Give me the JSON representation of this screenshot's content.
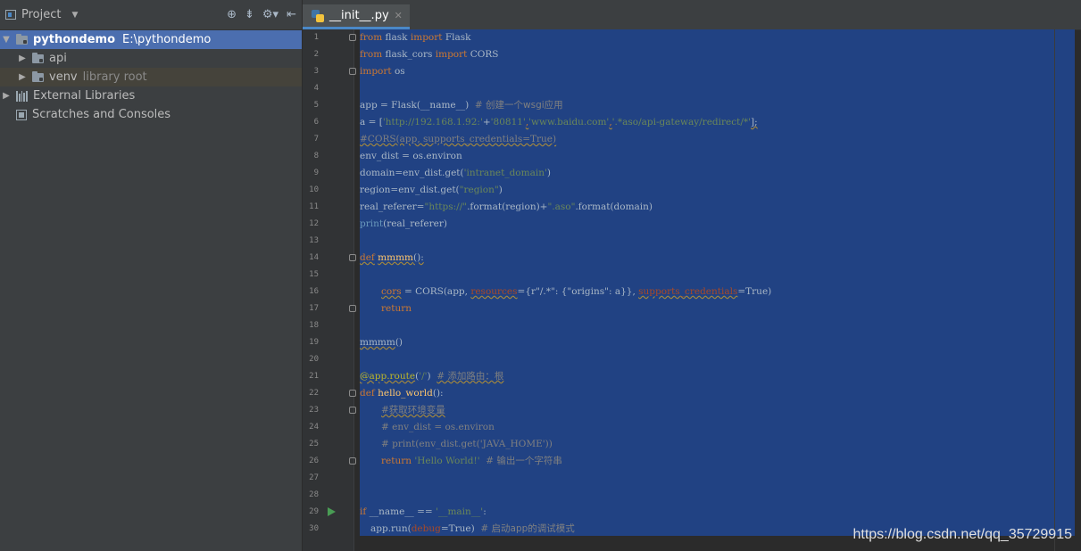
{
  "project_panel": {
    "title": "Project",
    "tree": [
      {
        "label": "pythondemo",
        "extra": "E:\\pythondemo",
        "selected": true
      },
      {
        "label": "api"
      },
      {
        "label": "venv",
        "extra": "library root"
      },
      {
        "label": "External Libraries"
      },
      {
        "label": "Scratches and Consoles"
      }
    ]
  },
  "editor": {
    "tab_label": "__init__.py",
    "lines": [
      {
        "n": "1"
      },
      {
        "n": "2"
      },
      {
        "n": "3"
      },
      {
        "n": "4"
      },
      {
        "n": "5"
      },
      {
        "n": "6"
      },
      {
        "n": "7"
      },
      {
        "n": "8"
      },
      {
        "n": "9"
      },
      {
        "n": "10"
      },
      {
        "n": "11"
      },
      {
        "n": "12"
      },
      {
        "n": "13"
      },
      {
        "n": "14"
      },
      {
        "n": "15"
      },
      {
        "n": "16"
      },
      {
        "n": "17"
      },
      {
        "n": "18"
      },
      {
        "n": "19"
      },
      {
        "n": "20"
      },
      {
        "n": "21"
      },
      {
        "n": "22"
      },
      {
        "n": "23"
      },
      {
        "n": "24"
      },
      {
        "n": "25"
      },
      {
        "n": "26"
      },
      {
        "n": "27"
      },
      {
        "n": "28"
      },
      {
        "n": "29"
      },
      {
        "n": "30"
      }
    ],
    "code": {
      "l1a": "from",
      "l1b": " flask ",
      "l1c": "import",
      "l1d": " Flask",
      "l2a": "from",
      "l2b": " flask_cors ",
      "l2c": "import",
      "l2d": " CORS",
      "l3a": "import",
      "l3b": " os",
      "l5a": "app = Flask(__name__)  ",
      "l5b": "# 创建一个wsgi应用",
      "l6a": "a = [",
      "l6b": "'http://192.168.1.92:'",
      "l6c": "+",
      "l6d": "'80811'",
      "l6e": ",",
      "l6f": "'www.baidu.com'",
      "l6g": ",",
      "l6h": "'.*aso/api-gateway/redirect/*'",
      "l6i": "];",
      "l7a": "#CORS(app, supports_credentials=True)",
      "l8a": "env_dist = os.environ",
      "l9a": "domain=env_dist.get(",
      "l9b": "'intranet_domain'",
      "l9c": ")",
      "l10a": "region=env_dist.get(",
      "l10b": "\"region\"",
      "l10c": ")",
      "l11a": "real_referer=",
      "l11b": "\"https://\"",
      "l11c": ".format(region)+",
      "l11d": "\".aso\"",
      "l11e": ".format(domain)",
      "l12a": "print",
      "l12b": "(real_referer)",
      "l14a": "def",
      "l14b": " ",
      "l14c": "mmmm",
      "l14d": "():",
      "l16a": "cors",
      "l16b": " = CORS(app, ",
      "l16c": "resources",
      "l16d": "={r\"/.*\": {\"origins\": a}}, ",
      "l16e": "supports_credentials",
      "l16f": "=True)",
      "l17a": "return",
      "l19a": "mmmm",
      "l19b": "()",
      "l21a": "@app.route",
      "l21b": "(",
      "l21c": "'/'",
      "l21d": ")  ",
      "l21e": "# 添加路由：根",
      "l22a": "def",
      "l22b": " ",
      "l22c": "hello_world",
      "l22d": "():",
      "l23a": "#获取环境变量",
      "l24a": "# env_dist = os.environ",
      "l25a": "# print(env_dist.get('JAVA_HOME'))",
      "l26a": "return",
      "l26b": " ",
      "l26c": "'Hello World!'",
      "l26d": "  ",
      "l26e": "# 输出一个字符串",
      "l29a": "if",
      "l29b": " __name__ == ",
      "l29c": "'__main__'",
      "l29d": ":",
      "l30a": "app.run(",
      "l30b": "debug",
      "l30c": "=True)  ",
      "l30d": "# 启动app的调试模式"
    }
  },
  "watermark": "https://blog.csdn.net/qq_35729915",
  "colors": {
    "selection": "#214283",
    "keyword": "#cc7832",
    "string": "#6a8759",
    "comment": "#808080",
    "panel": "#3c3f41"
  }
}
